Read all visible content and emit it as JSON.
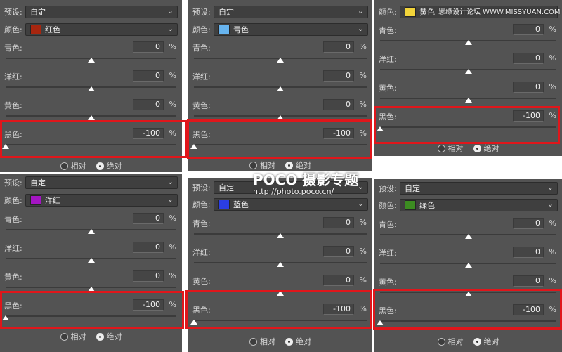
{
  "labels": {
    "preset": "预设:",
    "color": "颜色:",
    "relative": "相对",
    "absolute": "绝对",
    "percent": "%"
  },
  "accent": "#e0161b",
  "panels": [
    {
      "id": "p1",
      "preset": "自定",
      "color_name": "红色",
      "swatch": "#a7260f",
      "sliders": [
        {
          "name": "青色:",
          "value": "0",
          "pos": 0.5
        },
        {
          "name": "洋红:",
          "value": "0",
          "pos": 0.5
        },
        {
          "name": "黄色:",
          "value": "0",
          "pos": 0.5
        },
        {
          "name": "黑色:",
          "value": "-100",
          "pos": 0
        }
      ]
    },
    {
      "id": "p2",
      "preset": "自定",
      "color_name": "青色",
      "swatch": "#67b4ef",
      "sliders": [
        {
          "name": "青色:",
          "value": "0",
          "pos": 0.5
        },
        {
          "name": "洋红:",
          "value": "0",
          "pos": 0.5
        },
        {
          "name": "黄色:",
          "value": "0",
          "pos": 0.5
        },
        {
          "name": "黑色:",
          "value": "-100",
          "pos": 0
        }
      ]
    },
    {
      "id": "p3",
      "color_name": "黄色",
      "swatch": "#f2d43a",
      "sliders": [
        {
          "name": "青色:",
          "value": "0",
          "pos": 0.5
        },
        {
          "name": "洋红:",
          "value": "0",
          "pos": 0.5
        },
        {
          "name": "黄色:",
          "value": "0",
          "pos": 0.5
        },
        {
          "name": "黑色:",
          "value": "-100",
          "pos": 0
        }
      ]
    },
    {
      "id": "p4",
      "preset": "自定",
      "color_name": "洋红",
      "swatch": "#a415c3",
      "sliders": [
        {
          "name": "青色:",
          "value": "0",
          "pos": 0.5
        },
        {
          "name": "洋红:",
          "value": "0",
          "pos": 0.5
        },
        {
          "name": "黄色:",
          "value": "0",
          "pos": 0.5
        },
        {
          "name": "黑色:",
          "value": "-100",
          "pos": 0
        }
      ]
    },
    {
      "id": "p5",
      "preset": "自定",
      "color_name": "蓝色",
      "swatch": "#2b3ee3",
      "sliders": [
        {
          "name": "青色:",
          "value": "0",
          "pos": 0.5
        },
        {
          "name": "洋红:",
          "value": "0",
          "pos": 0.5
        },
        {
          "name": "黄色:",
          "value": "0",
          "pos": 0.5
        },
        {
          "name": "黑色:",
          "value": "-100",
          "pos": 0
        }
      ]
    },
    {
      "id": "p6",
      "preset": "自定",
      "color_name": "绿色",
      "swatch": "#3c8c21",
      "sliders": [
        {
          "name": "青色:",
          "value": "0",
          "pos": 0.5
        },
        {
          "name": "洋红:",
          "value": "0",
          "pos": 0.5
        },
        {
          "name": "黄色:",
          "value": "0",
          "pos": 0.5
        },
        {
          "name": "黑色:",
          "value": "-100",
          "pos": 0
        }
      ]
    }
  ],
  "watermark": {
    "site": "思缘设计论坛 WWW.MISSYUAN.COM",
    "brand": "POCO 摄影专题",
    "url": "http://photo.poco.cn/"
  }
}
